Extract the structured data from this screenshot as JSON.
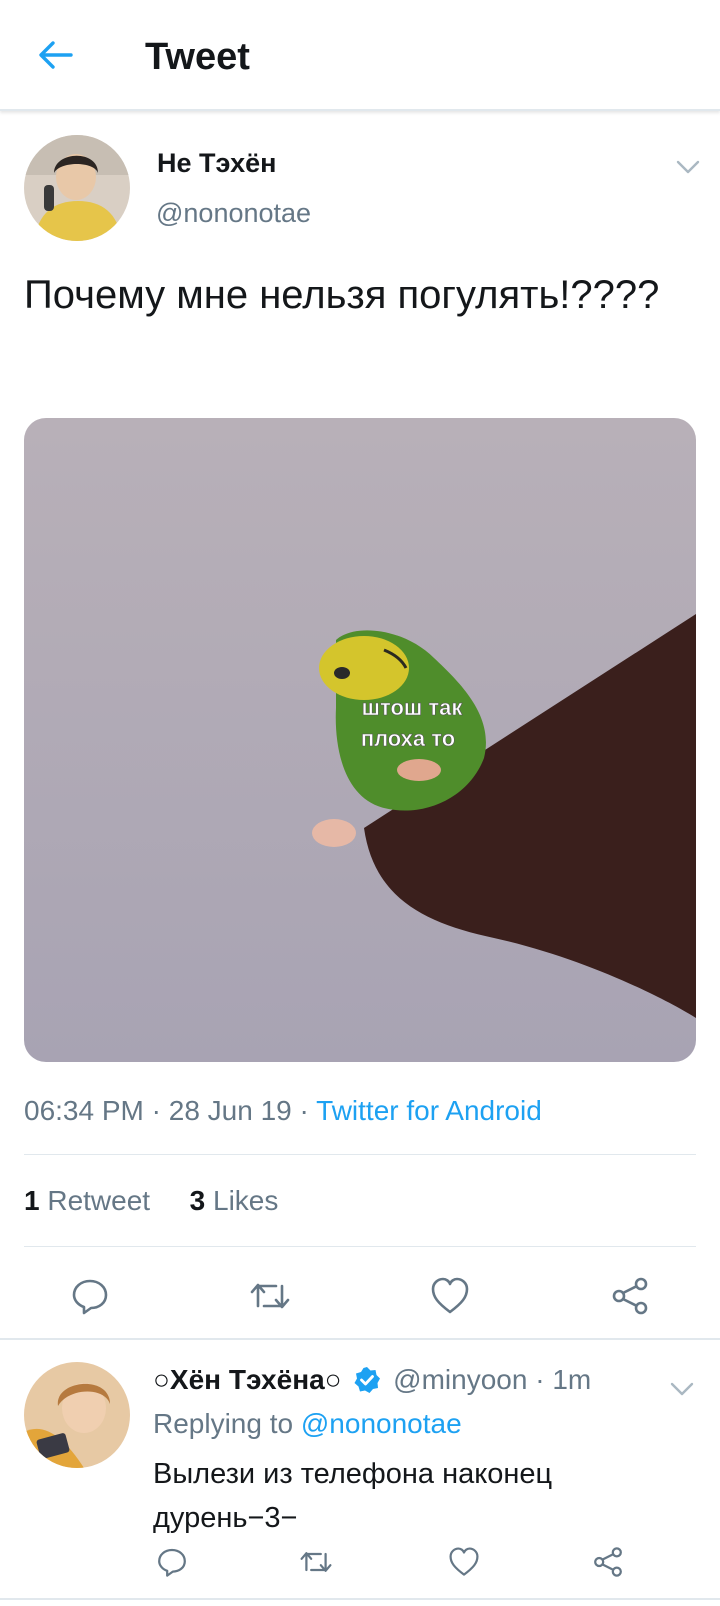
{
  "header": {
    "title": "Tweet",
    "back_icon": "arrow-left-icon",
    "accent": "#1da1f2"
  },
  "tweet": {
    "author_name": "Не Тэхён",
    "author_handle": "@nononotae",
    "text": "Почему мне нельзя погулять!????",
    "media": {
      "caption_line1": "штош так",
      "caption_line2": "плоха то"
    },
    "time": "06:34 PM",
    "date": "28 Jun 19",
    "source": "Twitter for Android",
    "retweet_count": "1",
    "retweet_label": "Retweet",
    "like_count": "3",
    "like_label": "Likes"
  },
  "actions": [
    "reply-icon",
    "retweet-icon",
    "like-icon",
    "share-icon"
  ],
  "reply": {
    "name": "○Хён Тэхёна○",
    "handle": "@minyoon",
    "separator": "·",
    "time": "1m",
    "replying_prefix": "Replying to",
    "replying_to": "@nononotae",
    "text": "Вылези из телефона наконец дурень−3−"
  },
  "colors": {
    "text": "#14171a",
    "secondary": "#657786",
    "link": "#1da1f2",
    "border": "#e1e8ed"
  }
}
